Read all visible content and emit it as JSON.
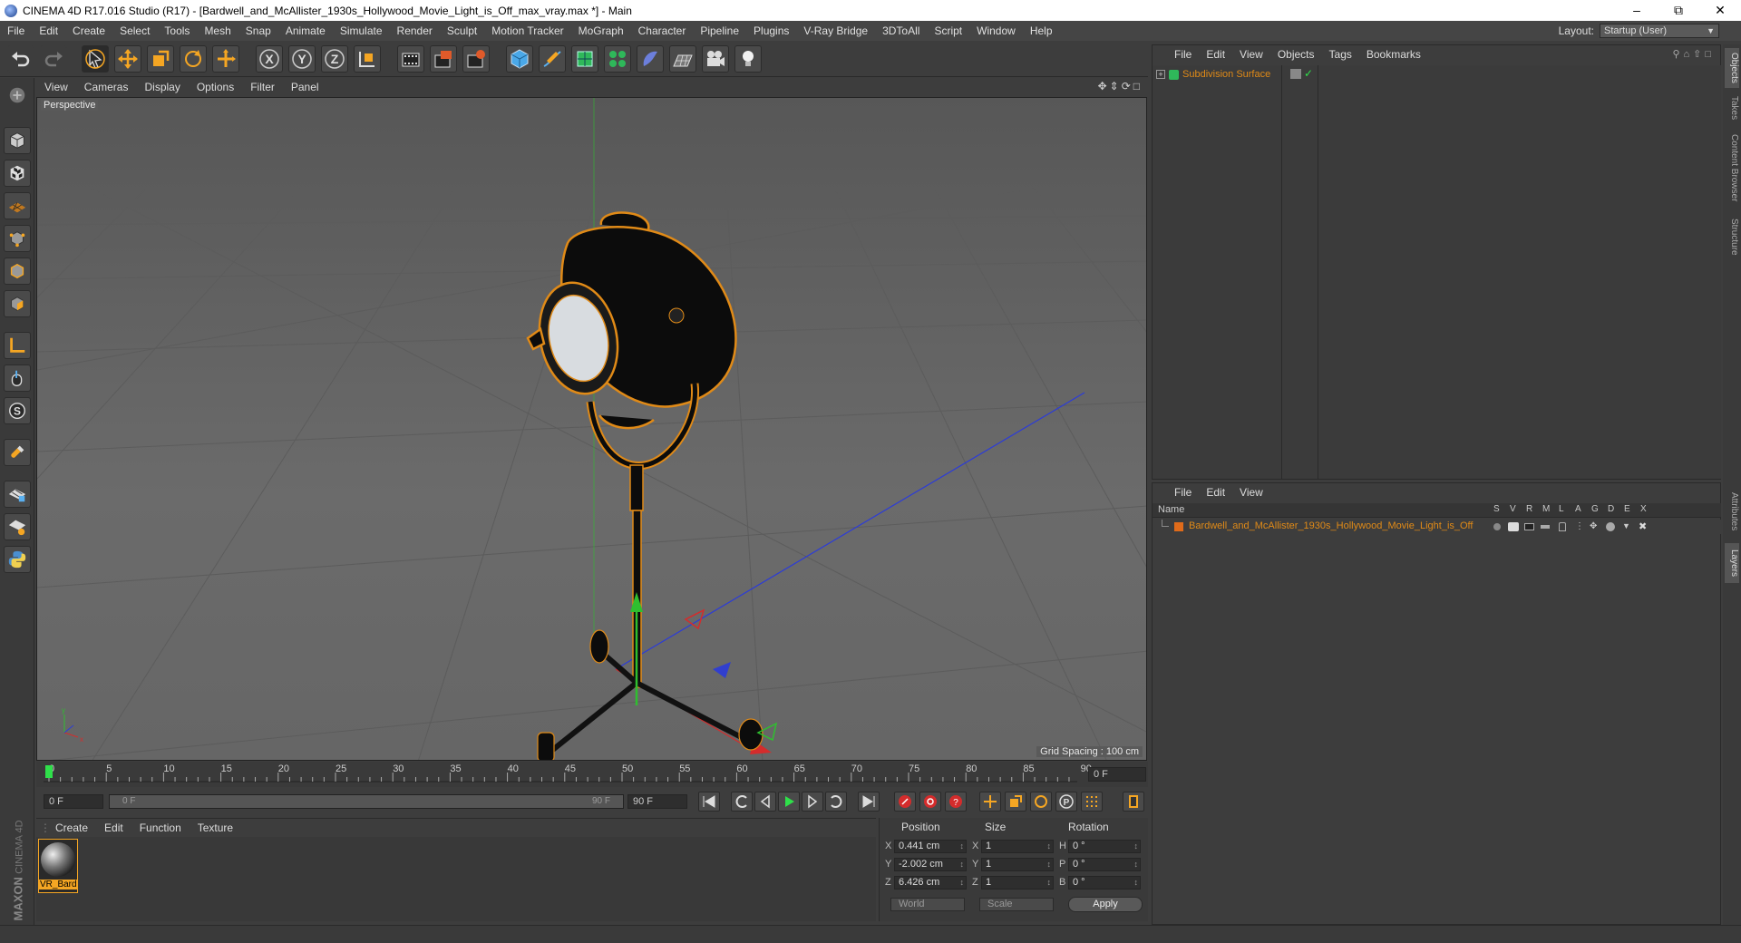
{
  "window": {
    "title": "CINEMA 4D R17.016 Studio (R17) - [Bardwell_and_McAllister_1930s_Hollywood_Movie_Light_is_Off_max_vray.max *] - Main",
    "controls": [
      "–",
      "⧉",
      "✕"
    ]
  },
  "menubar": [
    "File",
    "Edit",
    "Create",
    "Select",
    "Tools",
    "Mesh",
    "Snap",
    "Animate",
    "Simulate",
    "Render",
    "Sculpt",
    "Motion Tracker",
    "MoGraph",
    "Character",
    "Pipeline",
    "Plugins",
    "V-Ray Bridge",
    "3DToAll",
    "Script",
    "Window",
    "Help"
  ],
  "layout": {
    "label": "Layout:",
    "value": "Startup (User)"
  },
  "toolbar": {
    "icons": [
      "undo-icon",
      "redo-icon",
      "select-icon",
      "move-icon",
      "scale-icon",
      "rotate-icon",
      "transform-icon",
      "x-axis-icon",
      "y-axis-icon",
      "z-axis-icon",
      "coord-system-icon",
      "render-view-icon",
      "render-picture-viewer-icon",
      "render-settings-icon",
      "cube-icon",
      "pen-icon",
      "subdivision-icon",
      "array-icon",
      "deformer-icon",
      "floor-icon",
      "camera-icon",
      "light-icon"
    ],
    "axis_labels": [
      "X",
      "Y",
      "Z"
    ]
  },
  "left_tools": [
    "make-editable-icon",
    "model-mode-icon",
    "texture-mode-icon",
    "workplane-icon",
    "points-mode-icon",
    "edges-mode-icon",
    "polygons-mode-icon",
    "axis-mode-icon",
    "tweak-icon",
    "solo-icon",
    "magnet-icon",
    "snap-lock-icon",
    "snap-settings-icon",
    "python-icon"
  ],
  "viewport": {
    "menu": [
      "View",
      "Cameras",
      "Display",
      "Options",
      "Filter",
      "Panel"
    ],
    "label": "Perspective",
    "grid_spacing": "Grid Spacing : 100 cm"
  },
  "timeline": {
    "ticks": [
      "0",
      "5",
      "10",
      "15",
      "20",
      "25",
      "30",
      "35",
      "40",
      "45",
      "50",
      "55",
      "60",
      "65",
      "70",
      "75",
      "80",
      "85",
      "90"
    ],
    "current_frame": "0 F",
    "start_field": "0 F",
    "range_start": "0 F",
    "range_end": "90 F",
    "end_field": "90 F"
  },
  "material_manager": {
    "menu": [
      "Create",
      "Edit",
      "Function",
      "Texture"
    ],
    "materials": [
      {
        "name": "VR_Bard"
      }
    ]
  },
  "brand": {
    "line1": "MAXON",
    "line2": "CINEMA 4D"
  },
  "coordinates": {
    "headers": [
      "Position",
      "Size",
      "Rotation"
    ],
    "rows": [
      {
        "axis": "X",
        "pos": "0.441 cm",
        "size_axis": "X",
        "size": "1",
        "rot_axis": "H",
        "rot": "0 °"
      },
      {
        "axis": "Y",
        "pos": "-2.002 cm",
        "size_axis": "Y",
        "size": "1",
        "rot_axis": "P",
        "rot": "0 °"
      },
      {
        "axis": "Z",
        "pos": "6.426 cm",
        "size_axis": "Z",
        "size": "1",
        "rot_axis": "B",
        "rot": "0 °"
      }
    ],
    "mode1": "World",
    "mode2": "Scale",
    "apply": "Apply"
  },
  "object_manager": {
    "menu": [
      "File",
      "Edit",
      "View",
      "Objects",
      "Tags",
      "Bookmarks"
    ],
    "objects": [
      {
        "name": "Subdivision Surface"
      }
    ]
  },
  "layer_manager": {
    "menu": [
      "File",
      "Edit",
      "View"
    ],
    "header_name": "Name",
    "flags": [
      "S",
      "V",
      "R",
      "M",
      "L",
      "A",
      "G",
      "D",
      "E",
      "X"
    ],
    "layers": [
      {
        "name": "Bardwell_and_McAllister_1930s_Hollywood_Movie_Light_is_Off",
        "color": "#e06b1a"
      }
    ]
  },
  "right_tabs": [
    "Objects",
    "Takes",
    "Content Browser",
    "Structure",
    "Attributes",
    "Layers"
  ],
  "colors": {
    "accent": "#f5a623",
    "selection": "#e08a17",
    "x_axis": "#d42c2c",
    "y_axis": "#2fbf2f",
    "z_axis": "#2b3bd9"
  }
}
